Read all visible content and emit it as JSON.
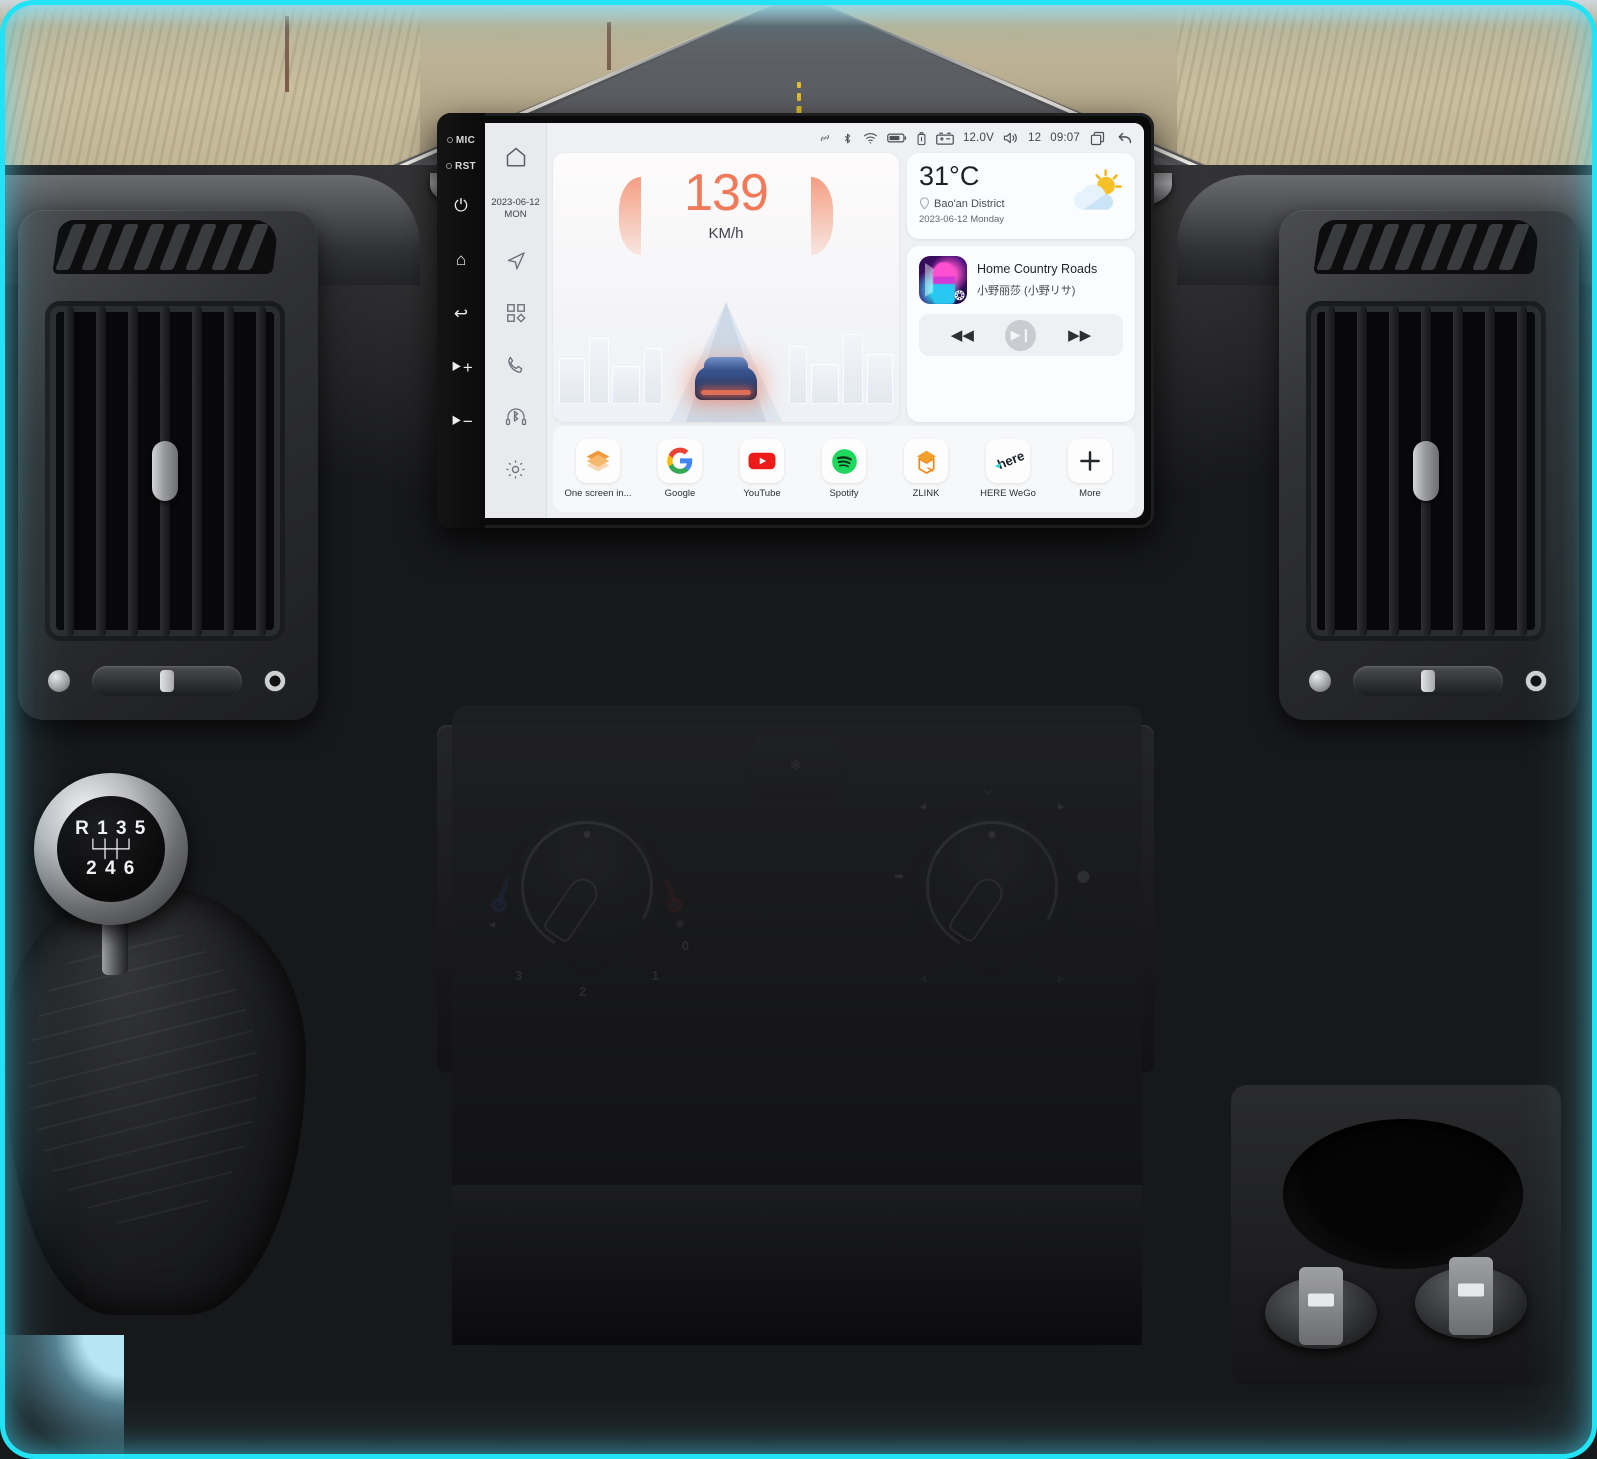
{
  "scene": {
    "description": "Car dashboard with Android head unit displaying home screen"
  },
  "windshield": {
    "label": "desert highway view"
  },
  "head_unit": {
    "hardware_buttons": [
      {
        "name": "mic",
        "label": "MIC"
      },
      {
        "name": "reset",
        "label": "RST"
      },
      {
        "name": "power",
        "glyph": "⏻"
      },
      {
        "name": "home",
        "glyph": "⌂"
      },
      {
        "name": "back",
        "glyph": "↩"
      },
      {
        "name": "volume-up",
        "glyph": "⯈+"
      },
      {
        "name": "volume-down",
        "glyph": "⯈−"
      }
    ],
    "sidebar": {
      "home_glyph": "⌂",
      "date": "2023-06-12",
      "weekday": "MON",
      "items": [
        {
          "name": "navigation",
          "glyph": "➤"
        },
        {
          "name": "apps",
          "glyph": "▦"
        },
        {
          "name": "phone",
          "glyph": "✆"
        },
        {
          "name": "bluetooth-audio",
          "glyph": "฿"
        },
        {
          "name": "settings",
          "glyph": "⚙"
        }
      ]
    },
    "statusbar": {
      "icons": [
        "link",
        "bluetooth",
        "wifi",
        "battery",
        "usb",
        "car-battery"
      ],
      "voltage": "12.0V",
      "volume": "12",
      "time": "09:07",
      "recents_label": "recents",
      "back_label": "back"
    },
    "speed_widget": {
      "value": "139",
      "unit": "KM/h"
    },
    "weather_widget": {
      "temperature": "31°C",
      "location": "Bao'an District",
      "date": "2023-06-12 Monday",
      "condition_icon": "sun-behind-cloud"
    },
    "music_widget": {
      "title": "Home Country Roads",
      "artist": "小野丽莎 (小野リサ)",
      "source_icon": "bluetooth",
      "prev_label": "◀◀",
      "play_label": "▶❙",
      "next_label": "▶▶"
    },
    "dock": [
      {
        "name": "one-screen",
        "label": "One screen in...",
        "icon": "layers"
      },
      {
        "name": "google",
        "label": "Google",
        "icon": "google-g"
      },
      {
        "name": "youtube",
        "label": "YouTube",
        "icon": "youtube-play"
      },
      {
        "name": "spotify",
        "label": "Spotify",
        "icon": "spotify"
      },
      {
        "name": "zlink",
        "label": "ZLINK",
        "icon": "zlink-diamond"
      },
      {
        "name": "here-wego",
        "label": "HERE WeGo",
        "icon": "here"
      },
      {
        "name": "more",
        "label": "More",
        "icon": "plus"
      }
    ]
  },
  "climate": {
    "left_dial": {
      "name": "temperature-fan-dial",
      "marks": [
        "0",
        "1",
        "2",
        "3"
      ],
      "icons": [
        "recirculate",
        "fan"
      ]
    },
    "right_dial": {
      "name": "air-distribution-dial",
      "icons": [
        "defrost",
        "face-left",
        "face-right",
        "feet-left",
        "feet-right",
        "windshield",
        "vent"
      ]
    },
    "recirculate_button": {
      "name": "recirculation",
      "glyph": "❄"
    }
  },
  "switch_strip": [
    {
      "name": "blank-left",
      "label": ""
    },
    {
      "name": "rear-window",
      "glyph": "▭"
    },
    {
      "name": "central-locking",
      "glyph": "⚿"
    },
    {
      "name": "hazard-lights",
      "glyph": "△"
    },
    {
      "name": "blank-mid",
      "label": ""
    },
    {
      "name": "rear-defrost",
      "glyph": "⌇"
    },
    {
      "name": "front-defrost",
      "glyph": "❂"
    }
  ],
  "gear_knob": {
    "top_row": "R 1 3 5",
    "pattern": "└┼┼┘",
    "bottom_row": "2 4 6"
  },
  "colors": {
    "accent_cyan": "#22e3f5",
    "hazard_red": "#e63027",
    "speed_orange": "#f07a5a",
    "screen_bg": "#eef0f3"
  }
}
